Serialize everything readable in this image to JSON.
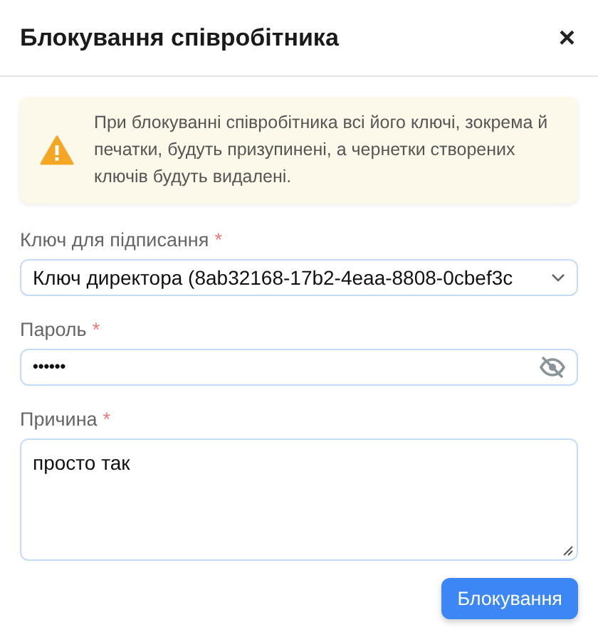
{
  "dialog": {
    "title": "Блокування співробітника",
    "close": "×"
  },
  "alert": {
    "text": "При блокуванні співробітника всі його ключі, зокрема й печатки, будуть призупинені, а чернетки створених ключів будуть видалені."
  },
  "fields": [
    {
      "kind": "select",
      "label": "Ключ для підписання",
      "required_mark": "*",
      "value": "Ключ директора (8ab32168-17b2-4eaa-8808-0cbef3c"
    },
    {
      "kind": "password",
      "label": "Пароль",
      "required_mark": "*",
      "value": "••••••"
    },
    {
      "kind": "textarea",
      "label": "Причина",
      "required_mark": "*",
      "value": "просто так"
    }
  ],
  "submit": "Блокування"
}
